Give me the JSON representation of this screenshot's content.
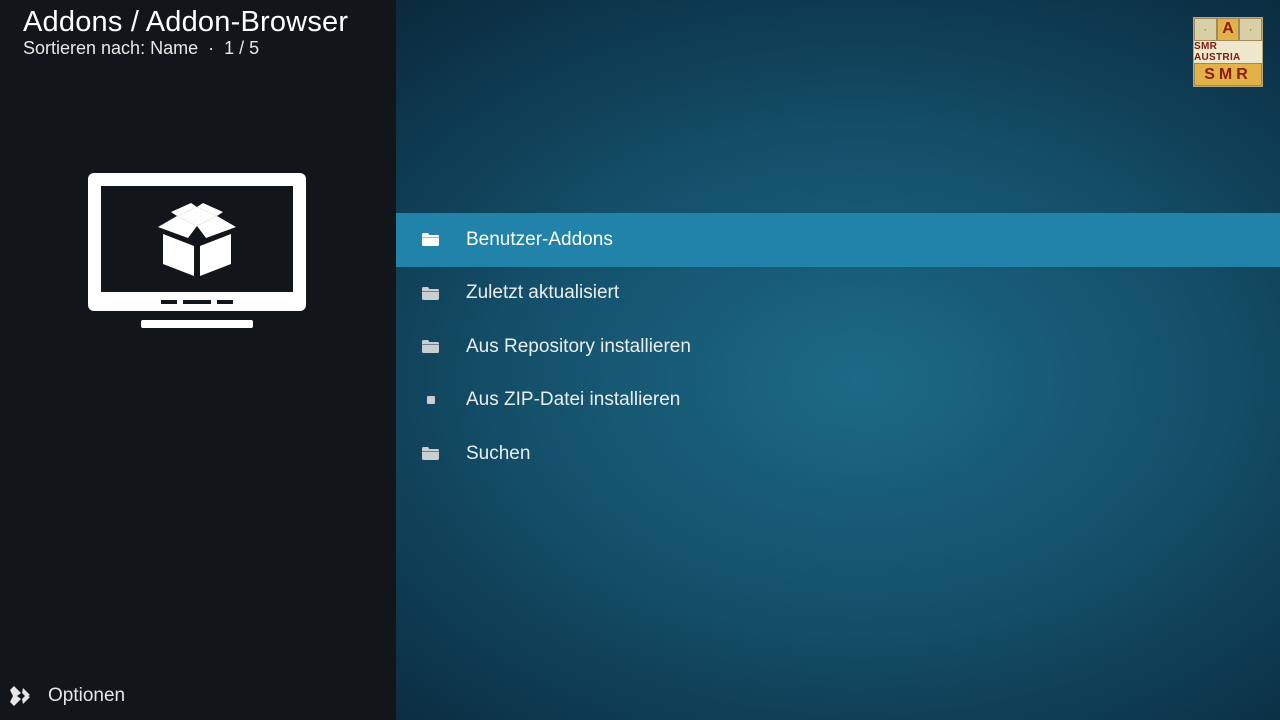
{
  "header": {
    "title": "Addons / Addon-Browser",
    "sort_label": "Sortieren nach: Name",
    "separator": "·",
    "position": "1 / 5"
  },
  "logo": {
    "top_letter": "A",
    "middle_text": "SMR AUSTRIA",
    "bottom_letters": "SMR"
  },
  "menu": {
    "items": [
      {
        "label": "Benutzer-Addons",
        "icon": "folder-icon",
        "focused": true
      },
      {
        "label": "Zuletzt aktualisiert",
        "icon": "folder-icon",
        "focused": false
      },
      {
        "label": "Aus Repository installieren",
        "icon": "folder-icon",
        "focused": false
      },
      {
        "label": "Aus ZIP-Datei installieren",
        "icon": "file-icon",
        "focused": false
      },
      {
        "label": "Suchen",
        "icon": "folder-icon",
        "focused": false
      }
    ]
  },
  "footer": {
    "options_label": "Optionen",
    "options_icon": "options-icon"
  },
  "colors": {
    "focus": "#2183a9",
    "left_panel": "#121519",
    "background": "#14506a"
  }
}
